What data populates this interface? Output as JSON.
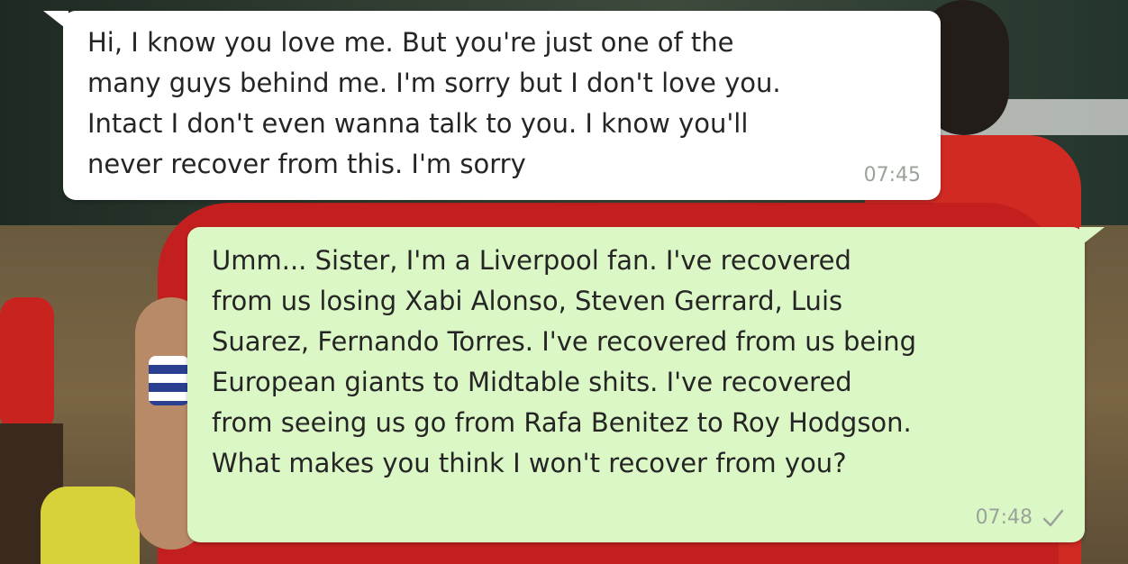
{
  "messages": [
    {
      "direction": "incoming",
      "text": "Hi, I know you love me. But you're just one of the\nmany guys behind me. I'm sorry but I don't love you.\nIntact I don't even wanna talk to you. I know you'll\nnever recover from this. I'm sorry",
      "time": "07:45"
    },
    {
      "direction": "outgoing",
      "text": "Umm... Sister, I'm a Liverpool fan. I've recovered\nfrom us losing Xabi Alonso, Steven Gerrard, Luis\nSuarez, Fernando Torres. I've recovered from us being\nEuropean giants to Midtable shits. I've recovered\nfrom seeing us go from Rafa Benitez to Roy Hodgson.\nWhat makes you think I won't recover from you?",
      "time": "07:48",
      "status_icon": "single-check-icon"
    }
  ],
  "colors": {
    "incoming_bubble": "#ffffff",
    "outgoing_bubble": "#dcf7c6",
    "text": "#252525",
    "meta": "#9aa39a"
  }
}
